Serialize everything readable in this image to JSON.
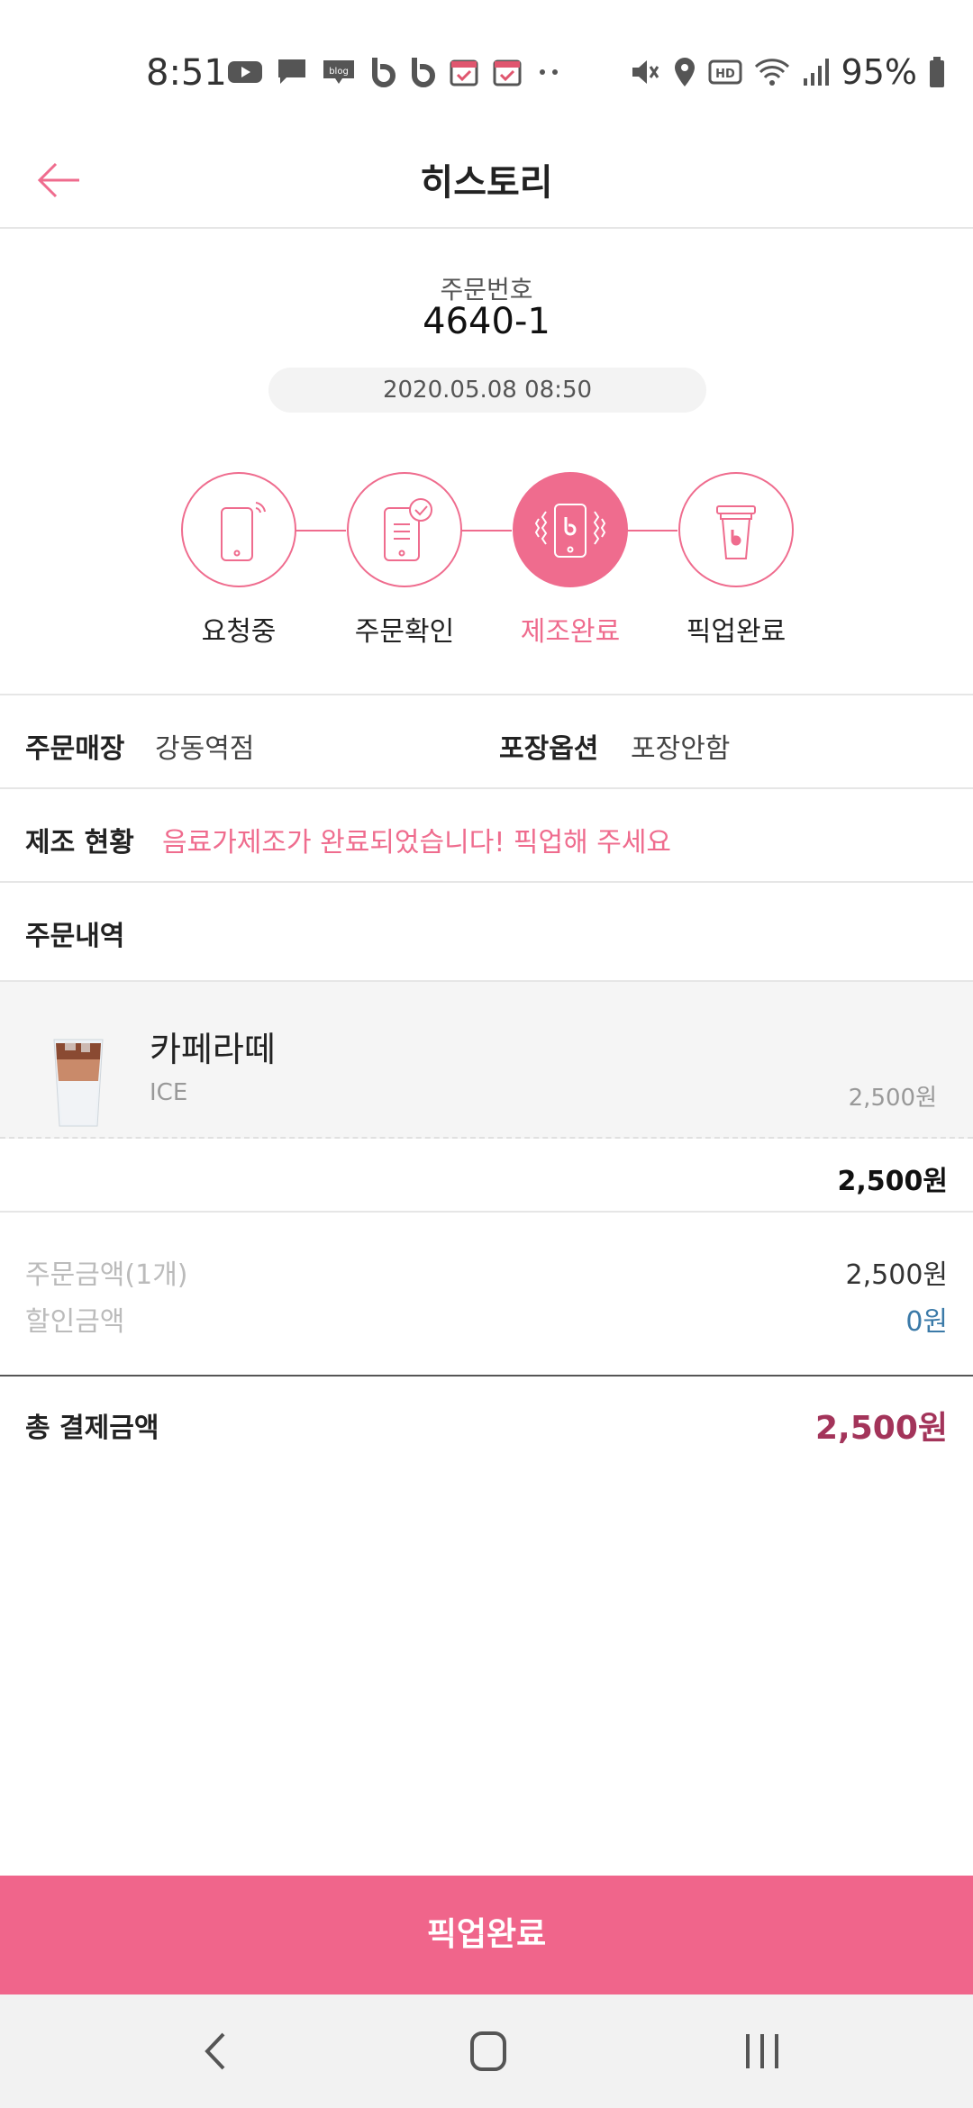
{
  "status_bar": {
    "time": "8:51",
    "battery": "95%",
    "left_icons": [
      "youtube-icon",
      "message-icon",
      "blog-icon",
      "b-app-icon",
      "b-app-icon",
      "calendar-check-icon",
      "calendar-check-icon",
      "more-dots-icon"
    ],
    "right_icons": [
      "mute-icon",
      "location-icon",
      "hd-icon",
      "wifi-icon",
      "signal-icon",
      "battery-icon"
    ]
  },
  "header": {
    "title": "히스토리",
    "back_icon": "back-arrow-icon"
  },
  "order": {
    "label": "주문번호",
    "number": "4640-1",
    "datetime": "2020.05.08 08:50"
  },
  "steps": [
    {
      "label": "요청중",
      "icon": "phone-signal-icon",
      "active": false
    },
    {
      "label": "주문확인",
      "icon": "tablet-check-icon",
      "active": false
    },
    {
      "label": "제조완료",
      "icon": "phone-vibrate-icon",
      "active": true
    },
    {
      "label": "픽업완료",
      "icon": "coffee-cup-icon",
      "active": false
    }
  ],
  "info": {
    "store_label": "주문매장",
    "store_value": "강동역점",
    "pack_label": "포장옵션",
    "pack_value": "포장안함",
    "status_label": "제조 현황",
    "status_value": "음료가제조가 완료되었습니다! 픽업해 주세요",
    "history_label": "주문내역"
  },
  "item": {
    "name": "카페라떼",
    "option": "ICE",
    "price": "2,500원",
    "image": "iced-latte-image"
  },
  "summary": {
    "subtotal": "2,500원",
    "order_amount_label": "주문금액(1개)",
    "order_amount_value": "2,500원",
    "discount_label": "할인금액",
    "discount_value": "0원",
    "total_label": "총 결제금액",
    "total_value": "2,500원"
  },
  "button": {
    "label": "픽업완료"
  },
  "colors": {
    "accent": "#ef6c8e",
    "button": "#f0658b",
    "total": "#a3345a",
    "discount": "#3b7aa8"
  }
}
